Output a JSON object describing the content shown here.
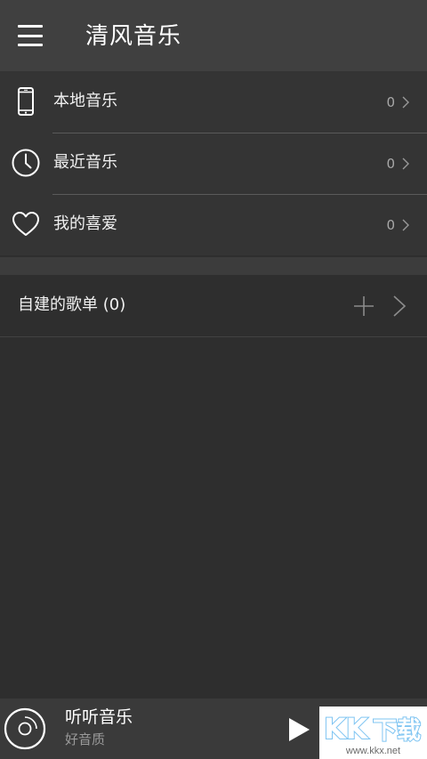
{
  "header": {
    "title": "清风音乐",
    "menu_icon": "hamburger-menu-icon"
  },
  "nav": {
    "items": [
      {
        "label": "本地音乐",
        "count": "0",
        "icon": "phone-icon"
      },
      {
        "label": "最近音乐",
        "count": "0",
        "icon": "clock-icon"
      },
      {
        "label": "我的喜爱",
        "count": "0",
        "icon": "heart-icon"
      }
    ]
  },
  "playlists": {
    "title": "自建的歌单 (0)",
    "add_icon": "plus-icon",
    "expand_icon": "chevron-right-icon"
  },
  "player": {
    "title": "听听音乐",
    "subtitle": "好音质",
    "disc_icon": "disc-icon",
    "play_icon": "play-icon"
  },
  "watermark": {
    "logo": "KK下载",
    "url": "www.kkx.net"
  },
  "colors": {
    "header_bg": "#404040",
    "nav_bg": "#343434",
    "content_bg": "#2e2e2e",
    "player_bg": "#3a3a3a",
    "watermark_accent": "#7ec4f2"
  }
}
